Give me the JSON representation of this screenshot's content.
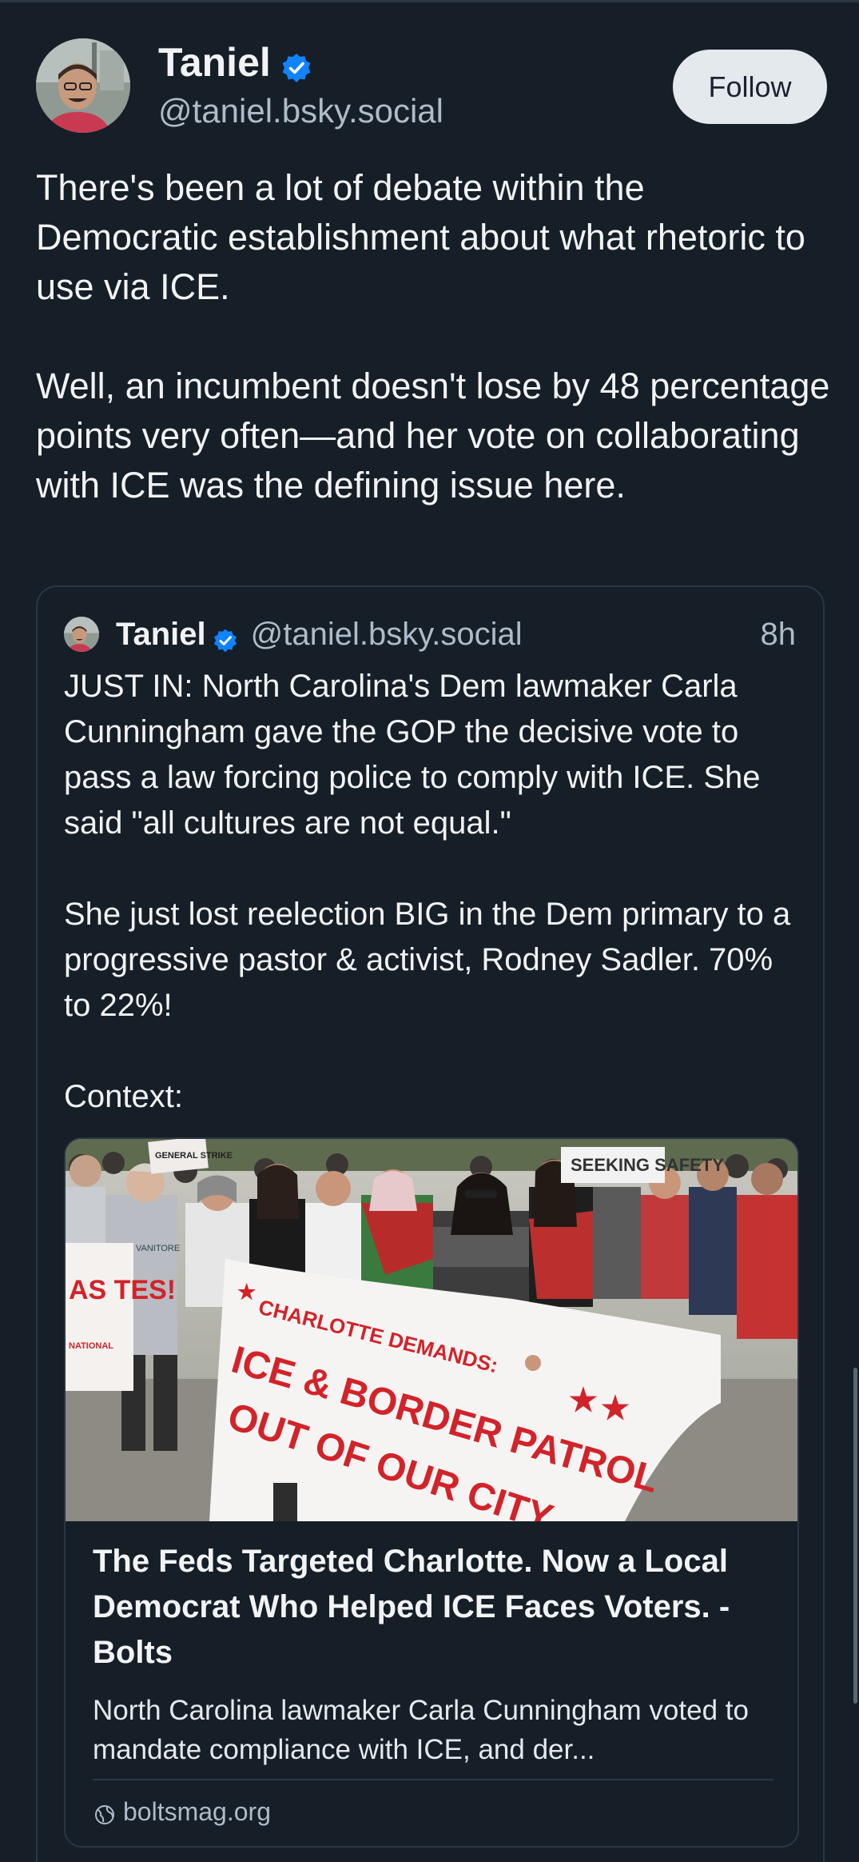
{
  "post": {
    "author_name": "Taniel",
    "author_handle": "@taniel.bsky.social",
    "follow_label": "Follow",
    "paragraphs": [
      "There's been a lot of debate within the Democratic establishment about what rhetoric to use via ICE.",
      "Well, an incumbent doesn't lose by 48 percentage points very often—and her vote on collaborating with ICE was the defining issue here."
    ]
  },
  "quote": {
    "author_name": "Taniel",
    "author_handle": "@taniel.bsky.social",
    "time": "8h",
    "paragraphs": [
      "JUST IN: North Carolina's Dem lawmaker Carla Cunningham gave the GOP the decisive vote to pass a law forcing police to comply with ICE. She said \"all cultures are not equal.\"",
      "She just lost reelection BIG in the Dem primary to a progressive pastor & activist, Rodney Sadler. 70% to 22%!",
      "Context:"
    ],
    "link": {
      "title": "The Feds Targeted Charlotte. Now a Local Democrat Who Helped ICE Faces Voters. - Bolts",
      "description": "North Carolina lawmaker Carla Cunningham voted to mandate compliance with ICE, and der...",
      "domain": "boltsmag.org",
      "image": {
        "banner_line1": "CHARLOTTE DEMANDS:",
        "banner_line2": "ICE & BORDER PATROL",
        "banner_line3": "OUT OF OUR CITY",
        "sign_left": "AS TES!",
        "sign_left_small": "NATIONAL",
        "sign_top": "GENERAL STRIKE",
        "sign_right": "SEEKING SAFETY",
        "shirt_text": "VANITORE"
      }
    }
  },
  "colors": {
    "background": "#161e27",
    "verified": "#1083fe",
    "muted": "#aebbc9",
    "banner_red": "#d2232a"
  }
}
